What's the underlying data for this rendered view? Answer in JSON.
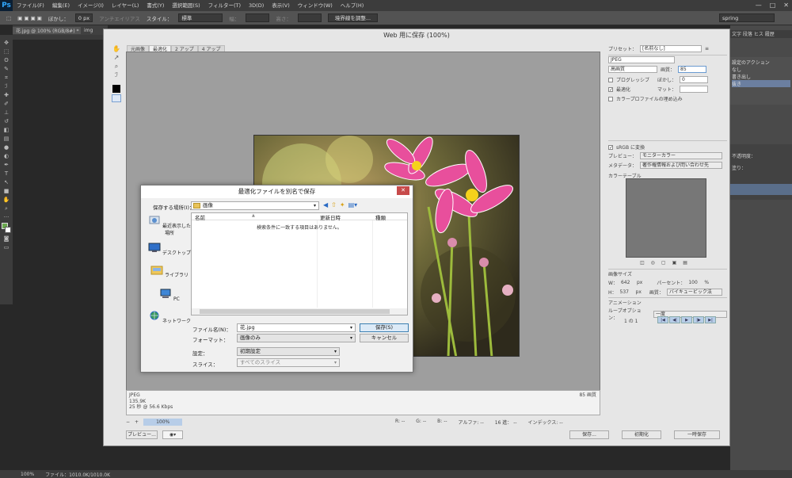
{
  "ps": {
    "logo": "Ps",
    "menu": [
      "ファイル(F)",
      "編集(E)",
      "イメージ(I)",
      "レイヤー(L)",
      "書式(Y)",
      "選択範囲(S)",
      "フィルター(T)",
      "3D(D)",
      "表示(V)",
      "ウィンドウ(W)",
      "ヘルプ(H)"
    ],
    "window_controls": [
      "—",
      "□",
      "✕"
    ],
    "options": {
      "blur_label": "ぼかし：",
      "blur_value": "0 px",
      "antialias": "アンチエイリアス",
      "style_label": "スタイル：",
      "style_value": "標準",
      "width_label": "幅：",
      "height_label": "高さ：",
      "refine_edge": "境界線を調整...",
      "workspace": "spring"
    },
    "doc_tab": "花.jpg @ 100% (RGB/8#) *",
    "doc_tab2": "img",
    "right_panel": {
      "tabs": "文字 段落 ヒス 履歴",
      "actions_title": "設定のアクション",
      "actions": [
        "なし",
        "書き出し",
        "抜き"
      ],
      "layers": [
        "不透明度：",
        "塗り："
      ]
    },
    "status": {
      "zoom": "100%",
      "file": "ファイル：1010.0K/1010.0K"
    }
  },
  "sfw": {
    "title": "Web 用に保存 (100%)",
    "view_tabs": [
      "元画像",
      "最適化",
      "2 アップ",
      "4 アップ"
    ],
    "info_left": [
      "JPEG",
      "135.9K",
      "25 秒 @ 56.6 Kbps"
    ],
    "info_right": "85 画質",
    "zoom": "100%",
    "readout": [
      "R: --",
      "G: --",
      "B: --",
      "アルファ: --",
      "16 進： --",
      "インデックス: --"
    ],
    "buttons": {
      "preview": "プレビュー...",
      "save": "保存...",
      "reset": "初期化",
      "remember": "一時保存"
    },
    "settings": {
      "preset_label": "プリセット：",
      "preset_value": "[名前なし]",
      "format": "JPEG",
      "quality_preset": "高画質",
      "quality_label": "画質：",
      "quality_value": "85",
      "progressive": "プログレッシブ",
      "optimized": "最適化",
      "blur_label": "ぼかし：",
      "blur_value": "0",
      "matte_label": "マット：",
      "embed_profile": "カラープロファイルの埋め込み",
      "srgb": "sRGB に変換",
      "preview_label": "プレビュー：",
      "preview_value": "モニターカラー",
      "metadata_label": "メタデータ：",
      "metadata_value": "著作権情報および問い合わせ先",
      "color_table": "カラーテーブル",
      "image_size": "画像サイズ",
      "w_label": "W：",
      "w_value": "642",
      "h_label": "H：",
      "h_value": "537",
      "px": "px",
      "percent_label": "パーセント：",
      "percent_value": "100",
      "percent_unit": "%",
      "resample_label": "画質：",
      "resample_value": "バイキュービック法",
      "animation": "アニメーション",
      "loop_label": "ループオプション：",
      "loop_value": "一度",
      "frame": "1 の 1",
      "anim_buttons": [
        "|◀",
        "◀|",
        "▶",
        "|▶",
        "▶|"
      ]
    }
  },
  "saveas": {
    "title": "最適化ファイルを別名で保存",
    "close": "✕",
    "location_label": "保存する場所(I)：",
    "location_value": "画像",
    "places": [
      "最近表示した場所",
      "デスクトップ",
      "ライブラリ",
      "PC",
      "ネットワーク"
    ],
    "columns": [
      "名前",
      "更新日時",
      "種類"
    ],
    "empty_message": "検索条件に一致する項目はありません。",
    "filename_label": "ファイル名(N)：",
    "filename_value": "花.jpg",
    "format_label": "フォーマット：",
    "format_value": "画像のみ",
    "settings_label": "設定：",
    "settings_value": "初期設定",
    "slices_label": "スライス：",
    "slices_value": "すべてのスライス",
    "save_button": "保存(S)",
    "cancel_button": "キャンセル"
  }
}
